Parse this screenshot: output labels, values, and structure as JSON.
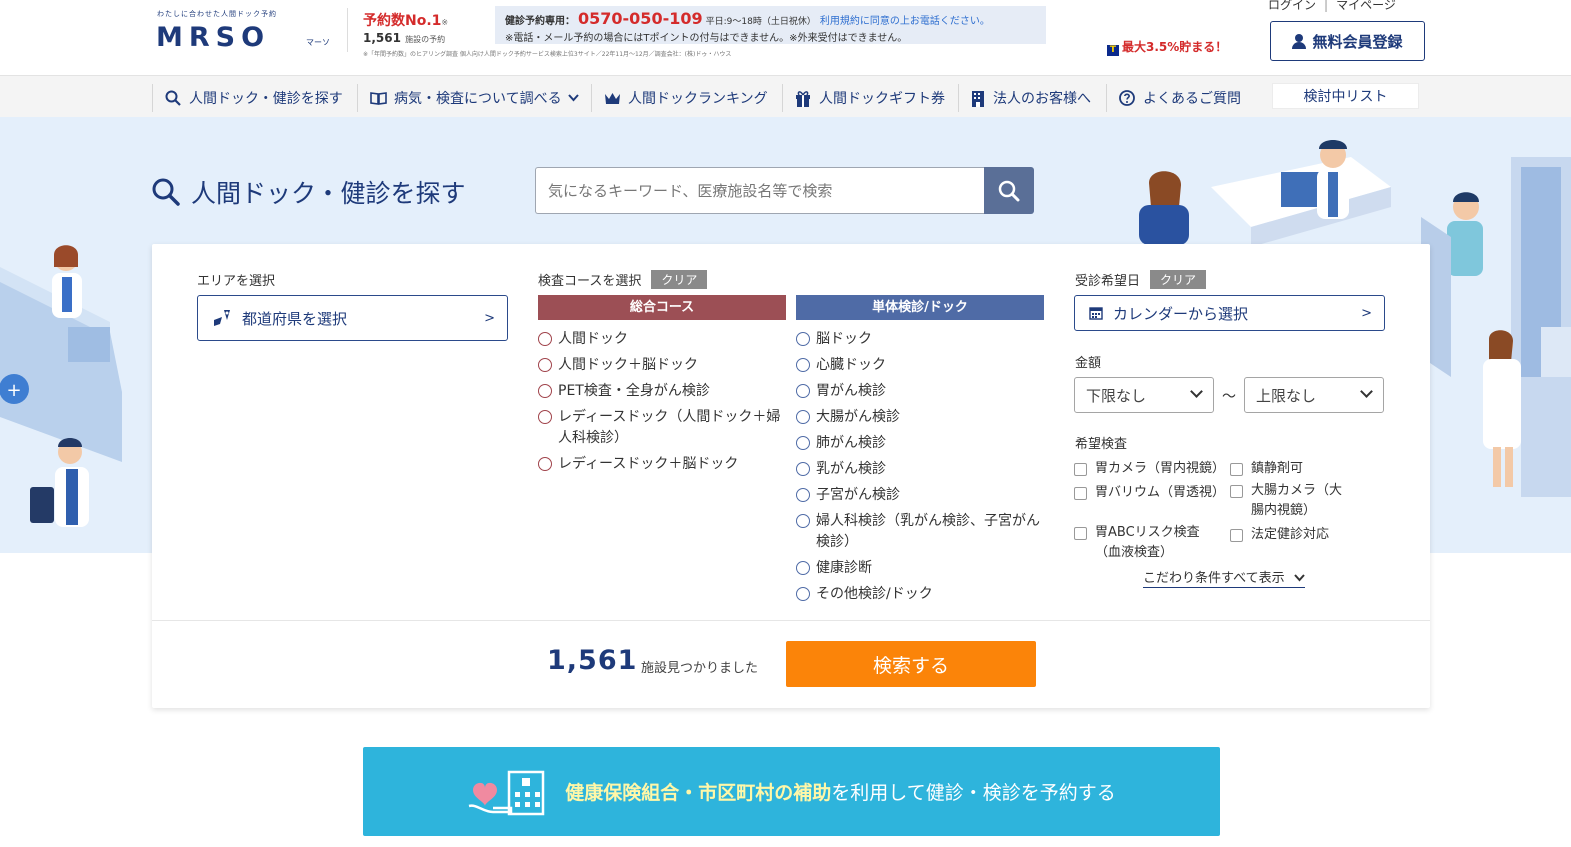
{
  "header": {
    "logo_tagline": "わたしに合わせた人間ドック予約",
    "logo": "MRSO",
    "logo_sub": "マーソ",
    "rank_label": "予約数No.1",
    "rank_mark": "※",
    "facility_count": "1,561",
    "facility_suffix": "施設の予約",
    "footnote": "※「年間予約数」のヒアリング調査 個人向け人間ドック予約サービス検索上位3サイト／22年11月〜12月／調査会社：(株)ドゥ・ハウス",
    "tel_label": "健診予約専用：",
    "tel_number": "0570-050-109",
    "tel_hours": "平日:9〜18時（土日祝休）",
    "tel_terms": "利用規約に同意の上お電話ください。",
    "tel_note": "※電話・メール予約の場合にはTポイントの付与はできません。※外来受付はできません。",
    "login": "ログイン",
    "separator": "|",
    "mypage": "マイページ",
    "points_icon": "T",
    "points": "最大3.5%貯まる！",
    "register_button": "無料会員登録"
  },
  "nav": {
    "items": [
      {
        "label": "人間ドック・健診を探す",
        "icon": "search-icon"
      },
      {
        "label": "病気・検査について調べる",
        "icon": "book-icon"
      },
      {
        "label": "人間ドックランキング",
        "icon": "crown-icon"
      },
      {
        "label": "人間ドックギフト券",
        "icon": "gift-icon"
      },
      {
        "label": "法人のお客様へ",
        "icon": "building-icon"
      },
      {
        "label": "よくあるご質問",
        "icon": "question-icon"
      }
    ],
    "list_button": "検討中リスト"
  },
  "search": {
    "title": "人間ドック・健診を探す",
    "placeholder": "気になるキーワード、医療施設名等で検索"
  },
  "form": {
    "area_label": "エリアを選択",
    "area_button": "都道府県を選択",
    "course_label": "検査コースを選択",
    "clear": "クリア",
    "general_header": "総合コース",
    "single_header": "単体検診/ドック",
    "general_courses": [
      "人間ドック",
      "人間ドック＋脳ドック",
      "PET検査・全身がん検診",
      "レディースドック（人間ドック＋婦人科検診）",
      "レディースドック＋脳ドック"
    ],
    "single_courses": [
      "脳ドック",
      "心臓ドック",
      "胃がん検診",
      "大腸がん検診",
      "肺がん検診",
      "乳がん検診",
      "子宮がん検診",
      "婦人科検診（乳がん検診、子宮がん検診）",
      "健康診断",
      "その他検診/ドック"
    ],
    "date_label": "受診希望日",
    "date_button": "カレンダーから選択",
    "price_label": "金額",
    "price_min": "下限なし",
    "price_tilde": "〜",
    "price_max": "上限なし",
    "exam_label": "希望検査",
    "exams": [
      "胃カメラ（胃内視鏡）",
      "鎮静剤可",
      "胃バリウム（胃透視）",
      "大腸カメラ（大腸内視鏡）",
      "胃ABCリスク検査（血液検査）",
      "法定健診対応"
    ],
    "more_label": "こだわり条件すべて表示",
    "result_count": "1,561",
    "result_label": "施設見つかりました",
    "search_button": "検索する"
  },
  "banner": {
    "highlight": "健康保険組合・市区町村の補助",
    "text": "を利用して健診・検診を予約する"
  },
  "colors": {
    "brand": "#1e3a7a",
    "accent_orange": "#fb8409",
    "general_red": "#9c4f55",
    "single_blue": "#4f6ba6",
    "banner": "#2eb4dc",
    "hero_bg": "#e4effb"
  }
}
